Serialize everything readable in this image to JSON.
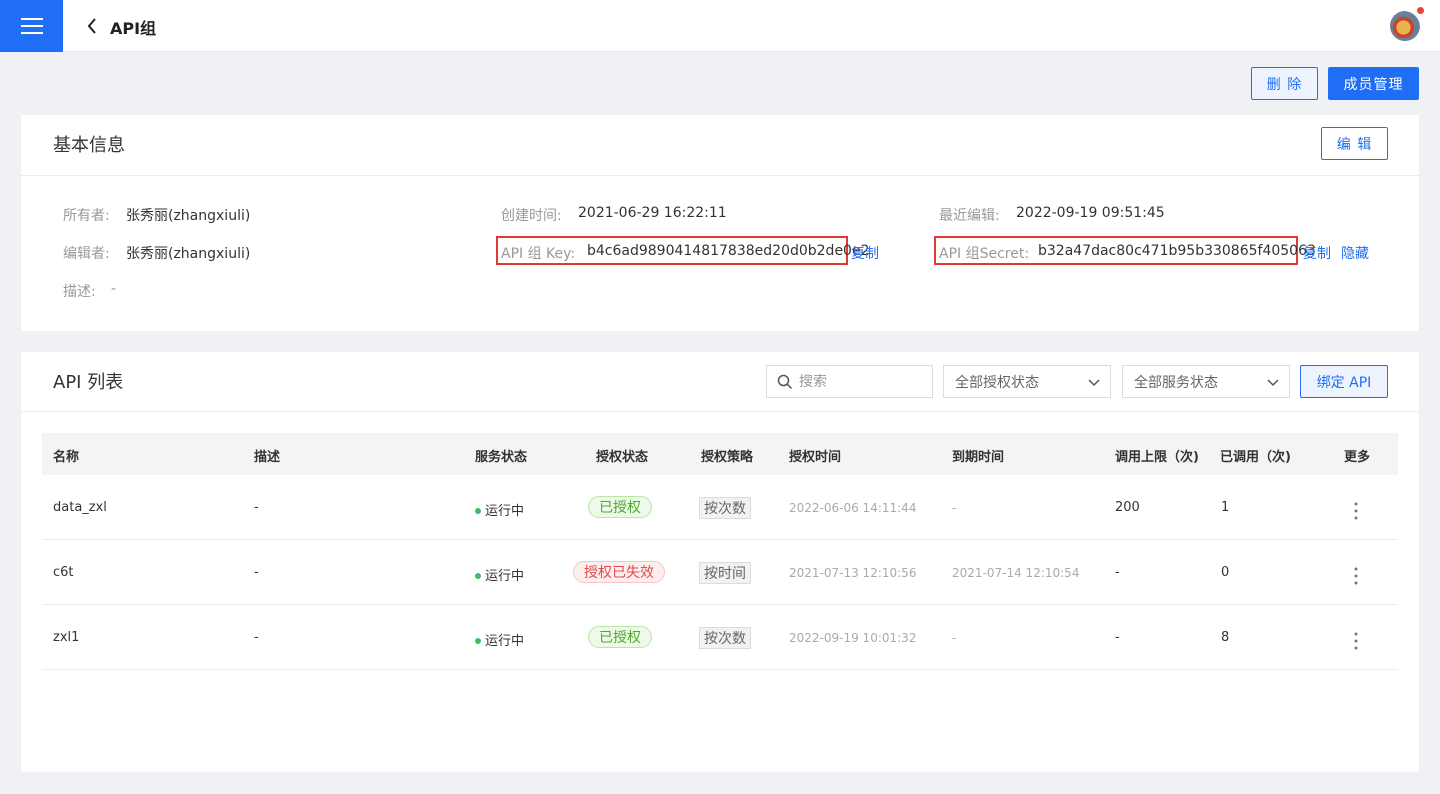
{
  "header": {
    "title": "API组",
    "menu_icon": "menu-icon",
    "back_icon": "chevron-left-icon"
  },
  "actions": {
    "delete_label": "删 除",
    "members_label": "成员管理"
  },
  "basic_info": {
    "title": "基本信息",
    "edit_label": "编 辑",
    "owner_label": "所有者:",
    "owner_value": "张秀丽(zhangxiuli)",
    "editor_label": "编辑者:",
    "editor_value": "张秀丽(zhangxiuli)",
    "desc_label": "描述:",
    "desc_value": "-",
    "created_label": "创建时间:",
    "created_value": "2021-06-29 16:22:11",
    "key_label": "API 组 Key:",
    "key_value": "b4c6ad9890414817838ed20d0b2de0e2",
    "key_copy": "复制",
    "last_edit_label": "最近编辑:",
    "last_edit_value": "2022-09-19 09:51:45",
    "secret_label": "API 组Secret:",
    "secret_value": "b32a47dac80c471b95b330865f405063",
    "secret_copy": "复制",
    "secret_hide": "隐藏"
  },
  "api_list": {
    "title": "API 列表",
    "search_placeholder": "搜索",
    "auth_filter": "全部授权状态",
    "service_filter": "全部服务状态",
    "bind_label": "绑定 API",
    "columns": [
      "名称",
      "描述",
      "服务状态",
      "授权状态",
      "授权策略",
      "授权时间",
      "到期时间",
      "调用上限（次)",
      "已调用（次)",
      "更多"
    ],
    "rows": [
      {
        "name": "data_zxl",
        "desc": "-",
        "service": "运行中",
        "auth": "已授权",
        "auth_ok": true,
        "strategy": "按次数",
        "auth_time": "2022-06-06 14:11:44",
        "expire": "-",
        "limit": "200",
        "called": "1"
      },
      {
        "name": "c6t",
        "desc": "-",
        "service": "运行中",
        "auth": "授权已失效",
        "auth_ok": false,
        "strategy": "按时间",
        "auth_time": "2021-07-13 12:10:56",
        "expire": "2021-07-14 12:10:54",
        "limit": "-",
        "called": "0"
      },
      {
        "name": "zxl1",
        "desc": "-",
        "service": "运行中",
        "auth": "已授权",
        "auth_ok": true,
        "strategy": "按次数",
        "auth_time": "2022-09-19 10:01:32",
        "expire": "-",
        "limit": "-",
        "called": "8"
      }
    ]
  },
  "colors": {
    "primary": "#1f6ef5",
    "success": "#4aab2a",
    "danger": "#e5484d",
    "highlight_box": "#e53935"
  }
}
